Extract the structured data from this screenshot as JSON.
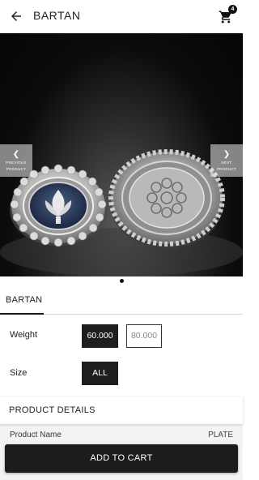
{
  "header": {
    "title": "BARTAN",
    "back_icon": "arrow-left-icon",
    "cart_icon": "shopping-cart-icon",
    "cart_count": "4"
  },
  "gallery": {
    "image_subject": "silver-bowls-photo",
    "prev_label_line1": "PREVIOUS",
    "prev_label_line2": "PRODUCT",
    "next_label_line1": "NEXT",
    "next_label_line2": "PRODUCT",
    "slide_count": 1,
    "active_slide": 1
  },
  "tabs": [
    {
      "label": "BARTAN",
      "active": true
    }
  ],
  "options": {
    "weight": {
      "label": "Weight",
      "values": [
        "60.000",
        "80.000"
      ],
      "selected": "60.000"
    },
    "size": {
      "label": "Size",
      "values": [
        "ALL"
      ],
      "selected": "ALL"
    }
  },
  "details": {
    "header": "PRODUCT DETAILS",
    "rows": [
      {
        "key": "Product Name",
        "value": "PLATE"
      }
    ]
  },
  "footer": {
    "add_to_cart_label": "ADD TO CART"
  },
  "colors": {
    "primary": "#1e1e1e",
    "background": "#ffffff",
    "details_bg": "#f3f3f3"
  }
}
